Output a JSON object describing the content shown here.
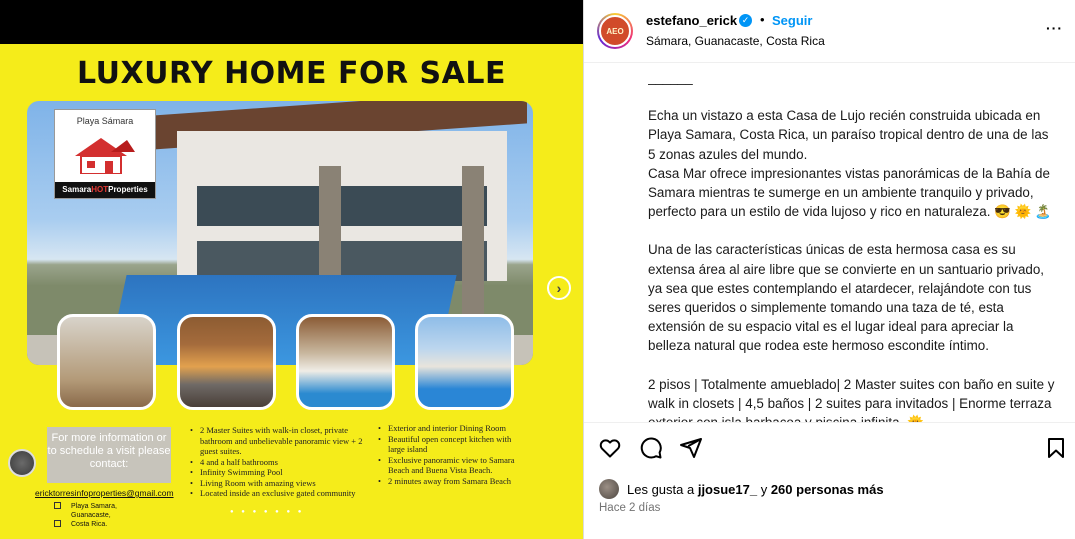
{
  "post_image": {
    "ad_title": "LUXURY HOME FOR SALE",
    "logo_top": "Playa Sámara",
    "logo_bottom_a": "Samara",
    "logo_bottom_hot": "HOT",
    "logo_bottom_b": "Properties",
    "contact_box": "For more information or to schedule a visit please contact:",
    "email": "ericktorresinfoproperties@gmail.com",
    "address": [
      "Playa Samara,",
      "Guanacaste,",
      "Costa Rica."
    ],
    "features_left": [
      "2 Master Suites with walk-in closet, private bathroom and unbelievable panoramic view + 2 guest suites.",
      "4 and a half bathrooms",
      "Infinity Swimming Pool",
      "Living Room with amazing views",
      "Located inside an exclusive gated community"
    ],
    "features_right": [
      "Exterior and interior Dining Room",
      "Beautiful open concept kitchen with large island",
      "Exclusive panoramic view to Samara Beach and Buena Vista Beach.",
      "2 minutes away from Samara Beach"
    ],
    "next_icon": "chevron-right-icon"
  },
  "header": {
    "username": "estefano_erick",
    "avatar_text": "AEO",
    "verified_icon": "verified-badge-icon",
    "separator": "•",
    "follow_label": "Seguir",
    "location": "Sámara, Guanacaste, Costa Rica",
    "more_icon": "more-options-icon",
    "more_label": "···"
  },
  "caption": {
    "divider": "______",
    "p1": "Echa un vistazo a esta Casa de Lujo recién construida ubicada en Playa Samara, Costa Rica, un paraíso tropical dentro de una de las 5 zonas azules del mundo.\nCasa Mar ofrece impresionantes vistas panorámicas de la Bahía de Samara mientras te sumerge en un ambiente tranquilo y privado, perfecto para un estilo de vida lujoso y rico en naturaleza. 😎 🌞 🏝️",
    "p2": "Una de las características únicas de esta hermosa casa es su extensa área al aire libre que se convierte en un santuario privado, ya sea que estes contemplando el atardecer, relajándote con tus seres queridos o simplemente tomando una taza de té, esta extensión de su espacio vital es el lugar ideal para apreciar la belleza natural que rodea este hermoso escondite íntimo.",
    "p3": "2 pisos | Totalmente amueblado| 2 Master suites con baño en suite y walk in closets | 4,5 baños | 2 suites para invitados | Enorme terraza exterior con isla barbacoa y piscina infinita. 🌞"
  },
  "actions": {
    "like_icon": "heart-icon",
    "comment_icon": "comment-icon",
    "share_icon": "share-icon",
    "save_icon": "bookmark-icon",
    "likes_prefix": "Les gusta a ",
    "likes_user": "jjosue17_",
    "likes_mid": " y ",
    "likes_count": "260 personas más",
    "time_ago": "Hace 2 días"
  }
}
